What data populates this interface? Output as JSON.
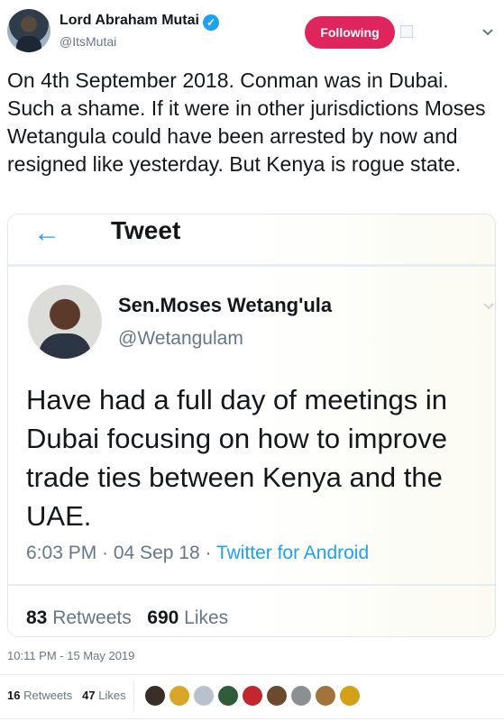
{
  "author": {
    "name": "Lord Abraham Mutai",
    "handle": "@ItsMutai",
    "follow_label": "Following"
  },
  "tweet": {
    "text": "On 4th September 2018. Conman was in Dubai. Such a shame. If it were in other jurisdictions Moses Wetangula could have been arrested by now and resigned like yesterday. But Kenya is rogue state.",
    "timestamp": "10:11 PM - 15 May 2019",
    "retweets_count": "16",
    "retweets_label": "Retweets",
    "likes_count": "47",
    "likes_label": "Likes"
  },
  "embedded": {
    "header_title": "Tweet",
    "name": "Sen.Moses Wetang'ula",
    "handle": "@Wetangulam",
    "text": "Have had a full day of meetings in Dubai focusing on how to improve trade ties between Kenya and the UAE.",
    "time": "6:03 PM · 04 Sep 18 · ",
    "via": "Twitter for Android",
    "retweets_count": "83",
    "retweets_label": "Retweets",
    "likes_count": "690",
    "likes_label": "Likes"
  },
  "icons": {
    "verified": "verified-badge-icon",
    "back": "back-arrow-icon",
    "caret": "chevron-down-icon"
  },
  "colors": {
    "follow_button": "#e0245e",
    "link": "#1da1f2",
    "muted": "#657786",
    "text": "#14171a"
  }
}
